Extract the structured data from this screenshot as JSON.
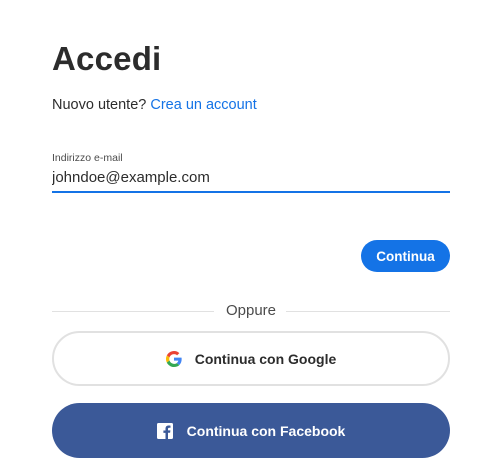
{
  "page": {
    "title": "Accedi",
    "new_user_prefix": "Nuovo utente?",
    "create_account_link": "Crea un account"
  },
  "email": {
    "label": "Indirizzo e-mail",
    "value": "johndoe@example.com"
  },
  "actions": {
    "continue_label": "Continua",
    "divider_text": "Oppure",
    "google_label": "Continua con Google",
    "facebook_label": "Continua con Facebook"
  },
  "colors": {
    "accent": "#1473e6",
    "facebook": "#3b5998",
    "text": "#2c2c2c"
  },
  "icons": {
    "google": "google-icon",
    "facebook": "facebook-icon"
  }
}
